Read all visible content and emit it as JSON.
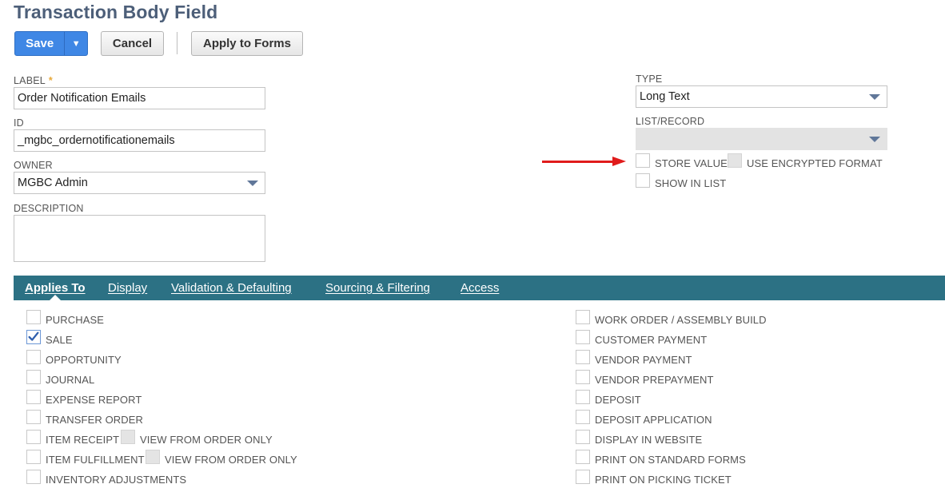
{
  "page": {
    "title": "Transaction Body Field"
  },
  "toolbar": {
    "save_label": "Save",
    "save_menu_glyph": "▼",
    "cancel_label": "Cancel",
    "apply_label": "Apply to Forms"
  },
  "form": {
    "label": {
      "label": "LABEL",
      "required_mark": "*",
      "value": "Order Notification Emails"
    },
    "id": {
      "label": "ID",
      "value": "_mgbc_ordernotificationemails"
    },
    "owner": {
      "label": "OWNER",
      "value": "MGBC Admin"
    },
    "description": {
      "label": "DESCRIPTION",
      "value": ""
    },
    "type": {
      "label": "TYPE",
      "value": "Long Text"
    },
    "list_record": {
      "label": "LIST/RECORD",
      "value": ""
    },
    "store_value": {
      "label": "STORE VALUE",
      "checked": false
    },
    "use_encrypted": {
      "label": "USE ENCRYPTED FORMAT",
      "checked": false
    },
    "show_in_list": {
      "label": "SHOW IN LIST",
      "checked": false
    }
  },
  "tabs": [
    {
      "label": "Applies To",
      "active": true
    },
    {
      "label": "Display",
      "active": false
    },
    {
      "label": "Validation & Defaulting",
      "active": false
    },
    {
      "label": "Sourcing & Filtering",
      "active": false
    },
    {
      "label": "Access",
      "active": false
    }
  ],
  "applies_left": [
    {
      "label": "PURCHASE",
      "checked": false
    },
    {
      "label": "SALE",
      "checked": true
    },
    {
      "label": "OPPORTUNITY",
      "checked": false
    },
    {
      "label": "JOURNAL",
      "checked": false
    },
    {
      "label": "EXPENSE REPORT",
      "checked": false
    },
    {
      "label": "TRANSFER ORDER",
      "checked": false
    },
    {
      "label": "ITEM RECEIPT",
      "checked": false,
      "sub_label": "VIEW FROM ORDER ONLY"
    },
    {
      "label": "ITEM FULFILLMENT",
      "checked": false,
      "sub_label": "VIEW FROM ORDER ONLY"
    },
    {
      "label": "INVENTORY ADJUSTMENTS",
      "checked": false
    }
  ],
  "applies_right": [
    {
      "label": "WORK ORDER / ASSEMBLY BUILD",
      "checked": false
    },
    {
      "label": "CUSTOMER PAYMENT",
      "checked": false
    },
    {
      "label": "VENDOR PAYMENT",
      "checked": false
    },
    {
      "label": "VENDOR PREPAYMENT",
      "checked": false
    },
    {
      "label": "DEPOSIT",
      "checked": false
    },
    {
      "label": "DEPOSIT APPLICATION",
      "checked": false
    },
    {
      "label": "DISPLAY IN WEBSITE",
      "checked": false
    },
    {
      "label": "PRINT ON STANDARD FORMS",
      "checked": false
    },
    {
      "label": "PRINT ON PICKING TICKET",
      "checked": false
    }
  ],
  "colors": {
    "accent_blue": "#3f87e5",
    "tab_bar": "#2c7184",
    "title": "#4d5f79",
    "annotation_arrow": "#e01b1b"
  }
}
